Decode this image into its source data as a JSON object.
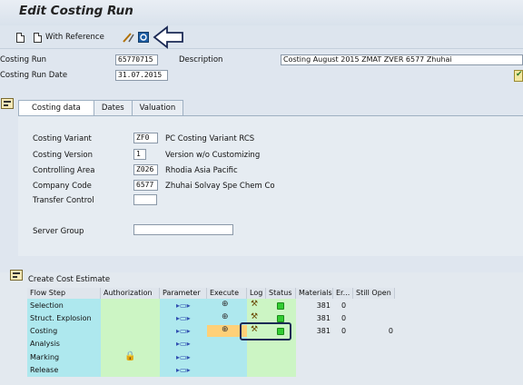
{
  "title": "Edit Costing Run",
  "toolbar": {
    "with_reference": "With Reference"
  },
  "header": {
    "costing_run_label": "Costing Run",
    "costing_run_value": "65770715",
    "description_label": "Description",
    "description_value": "Costing August 2015 ZMAT ZVER 6577 Zhuhai",
    "run_date_label": "Costing Run Date",
    "run_date_value": "31.07.2015"
  },
  "tabs": [
    "Costing data",
    "Dates",
    "Valuation"
  ],
  "costing_data": {
    "costing_variant_label": "Costing Variant",
    "costing_variant_value": "ZF0",
    "costing_variant_desc": "PC Costing Variant  RCS",
    "costing_version_label": "Costing Version",
    "costing_version_value": "1",
    "costing_version_desc": "Version w/o Customizing",
    "controlling_area_label": "Controlling Area",
    "controlling_area_value": "Z026",
    "controlling_area_desc": "Rhodia Asia Pacific",
    "company_code_label": "Company Code",
    "company_code_value": "6577",
    "company_code_desc": "Zhuhai Solvay Spe Chem Co",
    "transfer_control_label": "Transfer Control",
    "server_group_label": "Server Group"
  },
  "estimate": {
    "title": "Create Cost Estimate",
    "columns": [
      "Flow Step",
      "Authorization",
      "Parameter",
      "Execute",
      "Log",
      "Status",
      "Materials",
      "Er...",
      "Still Open"
    ],
    "rows": [
      {
        "step": "Selection",
        "materials": "381",
        "errors": "0",
        "still_open": ""
      },
      {
        "step": "Struct. Explosion",
        "materials": "381",
        "errors": "0",
        "still_open": ""
      },
      {
        "step": "Costing",
        "materials": "381",
        "errors": "0",
        "still_open": "0"
      },
      {
        "step": "Analysis",
        "materials": "",
        "errors": "",
        "still_open": ""
      },
      {
        "step": "Marking",
        "materials": "",
        "errors": "",
        "still_open": ""
      },
      {
        "step": "Release",
        "materials": "",
        "errors": "",
        "still_open": ""
      }
    ]
  },
  "colors": {
    "accent_cyan": "#aee8ee",
    "accent_green": "#ccf5c4",
    "highlight_orange": "#ffd078",
    "annotation": "#1b2a55"
  }
}
